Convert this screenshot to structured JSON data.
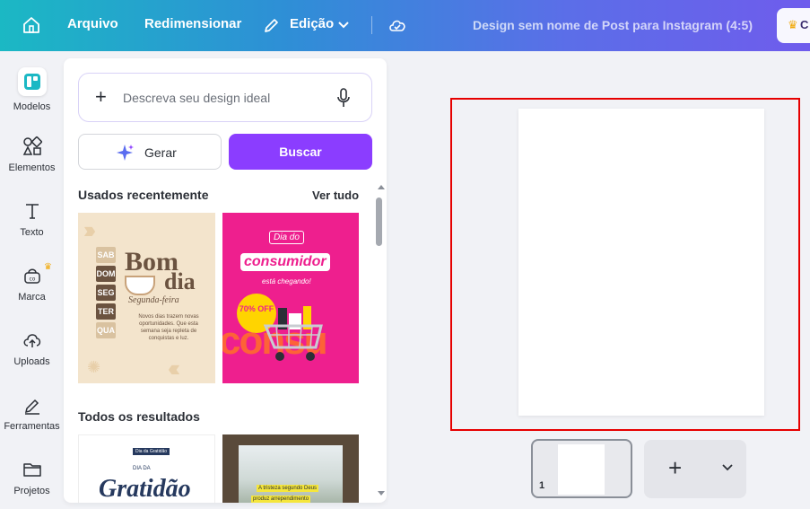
{
  "topbar": {
    "file_label": "Arquivo",
    "resize_label": "Redimensionar",
    "edit_label": "Edição",
    "doc_title": "Design sem nome de Post para Instagram (4:5)",
    "pro_label": "C"
  },
  "rail": {
    "items": [
      {
        "label": "Modelos",
        "icon": "templates-icon"
      },
      {
        "label": "Elementos",
        "icon": "elements-icon"
      },
      {
        "label": "Texto",
        "icon": "text-icon"
      },
      {
        "label": "Marca",
        "icon": "brand-icon"
      },
      {
        "label": "Uploads",
        "icon": "upload-icon"
      },
      {
        "label": "Ferramentas",
        "icon": "tools-icon"
      },
      {
        "label": "Projetos",
        "icon": "folder-icon"
      }
    ]
  },
  "panel": {
    "search_placeholder": "Descreva seu design ideal",
    "generate_label": "Gerar",
    "search_label": "Buscar",
    "recent_title": "Usados recentemente",
    "see_all": "Ver tudo",
    "all_results_title": "Todos os resultados",
    "templates": {
      "bomdia": {
        "days": [
          "SAB",
          "DOM",
          "SEG",
          "TER",
          "QUA"
        ],
        "title1": "Bom",
        "title2": "dia",
        "subtitle": "Segunda-feira",
        "body": "Novos dias trazem novas oportunidades. Que esta semana seja repleta de conquistas e luz."
      },
      "consumidor": {
        "tag": "Dia do",
        "title": "consumidor",
        "sub": "está chegando!",
        "off": "70% OFF",
        "bg_word": "consu"
      },
      "gratidao": {
        "small": "Dia da Gratidão",
        "diada": "DIA DA",
        "title": "Gratidão"
      },
      "tristeza": {
        "line1": "A tristeza segundo Deus",
        "line2": "produz arrependimento"
      }
    }
  },
  "canvas": {
    "page_number": "1"
  },
  "colors": {
    "accent": "#8b3dff",
    "selection": "#e60000"
  }
}
